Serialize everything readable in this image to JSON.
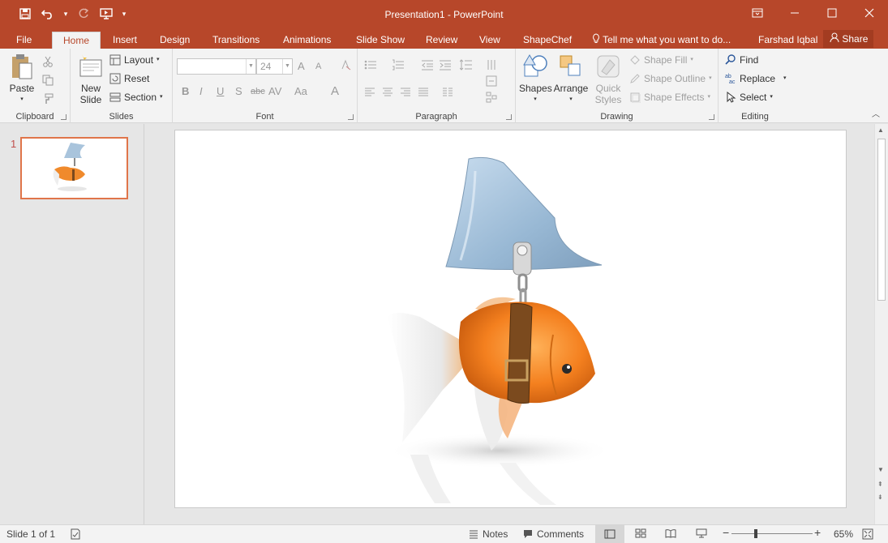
{
  "window": {
    "title": "Presentation1 - PowerPoint"
  },
  "tabs": [
    {
      "label": "File"
    },
    {
      "label": "Home"
    },
    {
      "label": "Insert"
    },
    {
      "label": "Design"
    },
    {
      "label": "Transitions"
    },
    {
      "label": "Animations"
    },
    {
      "label": "Slide Show"
    },
    {
      "label": "Review"
    },
    {
      "label": "View"
    },
    {
      "label": "ShapeChef"
    }
  ],
  "tell_me": "Tell me what you want to do...",
  "user_name": "Farshad Iqbal",
  "share_label": "Share",
  "ribbon": {
    "clipboard": {
      "paste": "Paste",
      "group": "Clipboard"
    },
    "slides": {
      "new_slide_1": "New",
      "new_slide_2": "Slide",
      "layout": "Layout",
      "reset": "Reset",
      "section": "Section",
      "group": "Slides"
    },
    "font": {
      "font_size": "24",
      "group": "Font",
      "bold": "B",
      "italic": "I",
      "underline": "U",
      "shadow": "S",
      "strike": "abc",
      "spacing": "AV",
      "case": "Aa",
      "color": "A",
      "grow": "A",
      "shrink": "A"
    },
    "paragraph": {
      "group": "Paragraph"
    },
    "drawing": {
      "shapes": "Shapes",
      "arrange": "Arrange",
      "quick_styles_1": "Quick",
      "quick_styles_2": "Styles",
      "shape_fill": "Shape Fill",
      "shape_outline": "Shape Outline",
      "shape_effects": "Shape Effects",
      "group": "Drawing"
    },
    "editing": {
      "find": "Find",
      "replace": "Replace",
      "select": "Select",
      "group": "Editing"
    }
  },
  "slide_pane": {
    "slide_number": "1"
  },
  "status": {
    "slide_info": "Slide 1 of 1",
    "notes": "Notes",
    "comments": "Comments",
    "zoom_out": "−",
    "zoom_in": "+",
    "zoom": "65%"
  },
  "colors": {
    "accent": "#b7472a",
    "thumb_border": "#e0754a"
  }
}
